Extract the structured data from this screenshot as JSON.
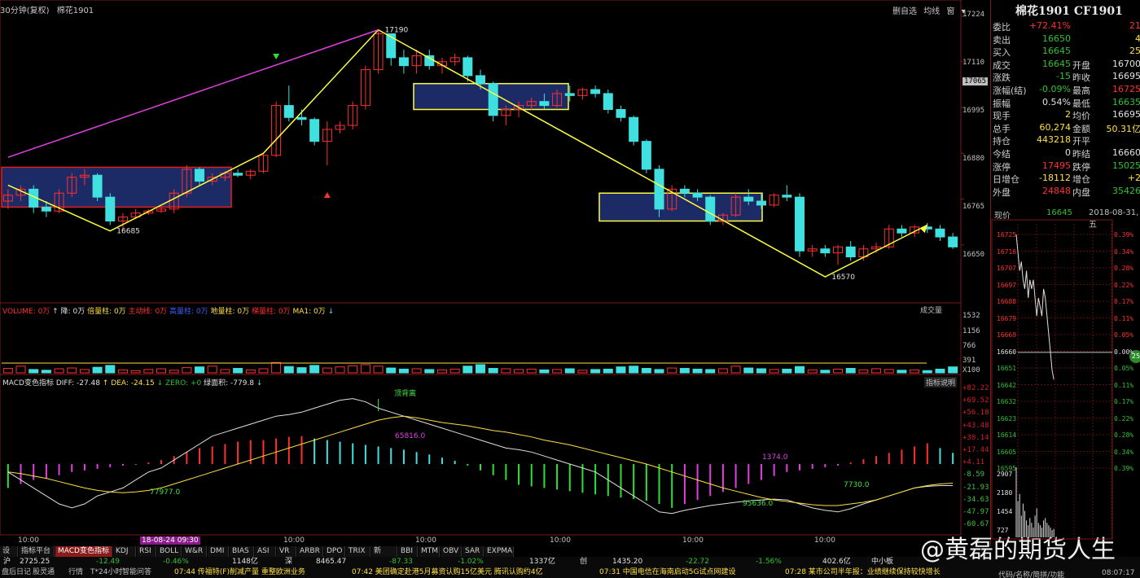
{
  "top": {
    "period": "30分钟(复权)",
    "symbol": "棉花1901",
    "tools": [
      "删自选",
      "均线",
      "窗",
      "▾"
    ]
  },
  "price_axis": [
    "17224",
    "17110",
    "17065",
    "16995",
    "16880",
    "16765",
    "16650"
  ],
  "volume_axis": [
    "1532",
    "1156",
    "766",
    "391",
    "X100"
  ],
  "macd_axis": [
    {
      "v": "+82.22",
      "c": "r"
    },
    {
      "v": "+69.52",
      "c": "r"
    },
    {
      "v": "+56.18",
      "c": "r"
    },
    {
      "v": "+43.48",
      "c": "r"
    },
    {
      "v": "+30.14",
      "c": "r"
    },
    {
      "v": "+17.44",
      "c": "r"
    },
    {
      "v": "+4.11",
      "c": "r"
    },
    {
      "v": "-8.59",
      "c": "g"
    },
    {
      "v": "-21.93",
      "c": "g"
    },
    {
      "v": "-34.63",
      "c": "g"
    },
    {
      "v": "-47.97",
      "c": "g"
    },
    {
      "v": "-60.67",
      "c": "g"
    }
  ],
  "price_labels": {
    "high": "17190",
    "low1": "16685",
    "low2": "16570",
    "chart_label": "成交量"
  },
  "volume_legend": [
    {
      "t": "VOLUME: 0万",
      "c": "red"
    },
    {
      "t": "↑ 降: 0万",
      "c": "white"
    },
    {
      "t": "倍量柱: 0万",
      "c": "yellow"
    },
    {
      "t": "主动线: 0万",
      "c": "red"
    },
    {
      "t": "高量柱: 0万",
      "c": "blue"
    },
    {
      "t": "地量柱: 0万",
      "c": "yellow"
    },
    {
      "t": "梯量柱: 0万",
      "c": "red"
    },
    {
      "t": "MA1: 0万",
      "c": "yellow"
    },
    {
      "t": "↓",
      "c": "cyan"
    }
  ],
  "macd_legend": [
    {
      "t": "MACD变色指标 DIFF: -27.48",
      "c": "white"
    },
    {
      "t": "↑ DEA: -24.15",
      "c": "yellow"
    },
    {
      "t": "↓ ZERO: +0",
      "c": "green"
    },
    {
      "t": "绿面积: -779.8",
      "c": "white"
    },
    {
      "t": "↓",
      "c": "cyan"
    }
  ],
  "macd_annotations": {
    "top_div": "顶背离",
    "a1": "65816.0",
    "a2": "77977.0",
    "a3": "1374.0",
    "a4": "7730.0",
    "a5": "95636.0",
    "explain": "指标说明"
  },
  "x_labels": [
    "10:00",
    "18-08-24 09:30",
    "10:00",
    "10:00",
    "10:00",
    "10:00",
    "10:00"
  ],
  "tabs": [
    "设置",
    "指标平台",
    "MACD变色指标",
    "KDJ",
    "RSI",
    "BOLL",
    "W&R",
    "DMI",
    "BIAS",
    "ASI",
    "VR",
    "ARBR",
    "DPO",
    "TRIX",
    "新DMA",
    "BBI",
    "MTM",
    "OBV",
    "SAR",
    "EXPMA"
  ],
  "index_bar": [
    {
      "t": "沪",
      "c": "white"
    },
    {
      "t": "2725.25",
      "c": "white"
    },
    {
      "t": "-12.49",
      "c": "white"
    },
    {
      "t": "-0.46%",
      "c": "white"
    },
    {
      "t": "1148亿",
      "c": "white"
    },
    {
      "t": "深",
      "c": "white"
    },
    {
      "t": "8465.47",
      "c": "white"
    },
    {
      "t": "-87.33",
      "c": "white"
    },
    {
      "t": "-1.02%",
      "c": "white"
    },
    {
      "t": "1337亿",
      "c": "white"
    },
    {
      "t": "创",
      "c": "white"
    },
    {
      "t": "1435.20",
      "c": "white"
    },
    {
      "t": "-22.72",
      "c": "white"
    },
    {
      "t": "-1.56%",
      "c": "white"
    },
    {
      "t": "402.6亿",
      "c": "white"
    },
    {
      "t": "中小板",
      "c": "white"
    }
  ],
  "news": [
    "盘后日记",
    "股灵通",
    "行情",
    "T*24小时",
    "智能问答",
    "07:44 传福特(F)削减产量 重整欧洲业务",
    "07:42 美团确定赴港5月募资认购15亿美元 腾讯认购约4亿",
    "07:31 中国电信在海南启动5G试点网建设",
    "07:28 某市公司半年报：业绩继续保持较快增长"
  ],
  "bottom_right": [
    "代码/名称/简拼/功能",
    "08:07:17"
  ],
  "quote": {
    "title": "棉花1901 CF1901",
    "rows": [
      {
        "l1": "委比",
        "v1": "+72.41%",
        "c1": "red",
        "l2": "",
        "v2": "21",
        "c2": "red"
      },
      {
        "l1": "卖出",
        "v1": "16650",
        "c1": "green",
        "l2": "",
        "v2": "4",
        "c2": "yellow"
      },
      {
        "l1": "买入",
        "v1": "16645",
        "c1": "green",
        "l2": "",
        "v2": "25",
        "c2": "yellow"
      },
      {
        "l1": "成交",
        "v1": "16645",
        "c1": "green",
        "l2": "开盘",
        "v2": "16700",
        "c2": "white"
      },
      {
        "l1": "涨跌",
        "v1": "-15",
        "c1": "green",
        "l2": "昨收",
        "v2": "16695",
        "c2": "white"
      },
      {
        "l1": "涨幅(结)",
        "v1": "-0.09%",
        "c1": "green",
        "l2": "最高",
        "v2": "16725",
        "c2": "red"
      },
      {
        "l1": "振幅",
        "v1": "0.54%",
        "c1": "white",
        "l2": "最低",
        "v2": "16635",
        "c2": "green"
      },
      {
        "l1": "现手",
        "v1": "2",
        "c1": "yellow",
        "l2": "均价",
        "v2": "16695",
        "c2": "white"
      },
      {
        "l1": "总手",
        "v1": "60,274",
        "c1": "yellow",
        "l2": "金额",
        "v2": "50.31亿",
        "c2": "yellow"
      },
      {
        "l1": "持仓",
        "v1": "443218",
        "c1": "yellow",
        "l2": "开平",
        "v2": "",
        "c2": "white"
      },
      {
        "l1": "今结",
        "v1": "0",
        "c1": "white",
        "l2": "昨结",
        "v2": "16660",
        "c2": "white"
      },
      {
        "l1": "涨停",
        "v1": "17495",
        "c1": "red",
        "l2": "跌停",
        "v2": "15025",
        "c2": "green"
      },
      {
        "l1": "日增仓",
        "v1": "-18112",
        "c1": "yellow",
        "l2": "增仓",
        "v2": "+2",
        "c2": "yellow"
      },
      {
        "l1": "外盘",
        "v1": "24848",
        "c1": "red",
        "l2": "内盘",
        "v2": "35426",
        "c2": "green"
      }
    ],
    "now_label": "现价",
    "now_value": "16645",
    "date": "2018-08-31,五"
  },
  "mini_left_axis": [
    {
      "v": "16725",
      "c": "r"
    },
    {
      "v": "16716",
      "c": "r"
    },
    {
      "v": "16707",
      "c": "r"
    },
    {
      "v": "16697",
      "c": "r"
    },
    {
      "v": "16688",
      "c": "r"
    },
    {
      "v": "16679",
      "c": "r"
    },
    {
      "v": "16669",
      "c": "r"
    },
    {
      "v": "16660",
      "c": "w"
    },
    {
      "v": "16651",
      "c": "g"
    },
    {
      "v": "16642",
      "c": "g"
    },
    {
      "v": "16632",
      "c": "g"
    },
    {
      "v": "16623",
      "c": "g"
    },
    {
      "v": "16614",
      "c": "g"
    },
    {
      "v": "16605",
      "c": "g"
    },
    {
      "v": "16595",
      "c": "g"
    }
  ],
  "mini_right_axis": [
    {
      "v": "0.39%",
      "c": "r"
    },
    {
      "v": "0.34%",
      "c": "r"
    },
    {
      "v": "0.28%",
      "c": "r"
    },
    {
      "v": "0.22%",
      "c": "r"
    },
    {
      "v": "0.17%",
      "c": "r"
    },
    {
      "v": "0.11%",
      "c": "r"
    },
    {
      "v": "0.05%",
      "c": "r"
    },
    {
      "v": "0.00%",
      "c": "w"
    },
    {
      "v": "0.05%",
      "c": "g"
    },
    {
      "v": "0.11%",
      "c": "g"
    },
    {
      "v": "0.17%",
      "c": "g"
    },
    {
      "v": "0.22%",
      "c": "g"
    },
    {
      "v": "0.28%",
      "c": "g"
    },
    {
      "v": "0.34%",
      "c": "g"
    },
    {
      "v": "0.39%",
      "c": "g"
    }
  ],
  "mini_vol_axis": [
    "2907",
    "2180",
    "1454",
    "727"
  ],
  "mini_badge": "25",
  "watermark": "@黄磊的期货人生",
  "chart_data": {
    "type": "candlestick",
    "candles": [
      [
        16760,
        16790,
        16740,
        16775
      ],
      [
        16775,
        16800,
        16760,
        16790
      ],
      [
        16790,
        16800,
        16730,
        16745
      ],
      [
        16745,
        16760,
        16720,
        16735
      ],
      [
        16735,
        16790,
        16730,
        16780
      ],
      [
        16780,
        16830,
        16770,
        16820
      ],
      [
        16820,
        16840,
        16800,
        16825
      ],
      [
        16825,
        16830,
        16760,
        16770
      ],
      [
        16770,
        16780,
        16700,
        16710
      ],
      [
        16710,
        16730,
        16685,
        16720
      ],
      [
        16720,
        16740,
        16715,
        16730
      ],
      [
        16730,
        16740,
        16725,
        16735
      ],
      [
        16735,
        16745,
        16730,
        16740
      ],
      [
        16740,
        16790,
        16730,
        16780
      ],
      [
        16780,
        16850,
        16770,
        16840
      ],
      [
        16840,
        16845,
        16800,
        16810
      ],
      [
        16810,
        16830,
        16800,
        16820
      ],
      [
        16820,
        16835,
        16810,
        16830
      ],
      [
        16830,
        16840,
        16820,
        16825
      ],
      [
        16825,
        16840,
        16815,
        16835
      ],
      [
        16835,
        16880,
        16830,
        16875
      ],
      [
        16875,
        17010,
        16870,
        17000
      ],
      [
        17000,
        17050,
        16960,
        16970
      ],
      [
        16970,
        16990,
        16950,
        16965
      ],
      [
        16965,
        16970,
        16900,
        16910
      ],
      [
        16910,
        16960,
        16850,
        16940
      ],
      [
        16940,
        16960,
        16930,
        16950
      ],
      [
        16950,
        17010,
        16940,
        17000
      ],
      [
        17000,
        17100,
        16990,
        17090
      ],
      [
        17090,
        17190,
        17080,
        17180
      ],
      [
        17180,
        17170,
        17100,
        17120
      ],
      [
        17120,
        17140,
        17080,
        17100
      ],
      [
        17100,
        17140,
        17080,
        17125
      ],
      [
        17125,
        17140,
        17090,
        17100
      ],
      [
        17100,
        17120,
        17080,
        17110
      ],
      [
        17110,
        17130,
        17100,
        17120
      ],
      [
        17120,
        17125,
        17060,
        17075
      ],
      [
        17075,
        17090,
        17040,
        17055
      ],
      [
        17055,
        17060,
        16960,
        16975
      ],
      [
        16975,
        17000,
        16950,
        16990
      ],
      [
        16990,
        17010,
        16970,
        17000
      ],
      [
        17000,
        17020,
        16990,
        17010
      ],
      [
        17010,
        17030,
        16990,
        17000
      ],
      [
        17000,
        17040,
        16995,
        17030
      ],
      [
        17030,
        17050,
        17010,
        17025
      ],
      [
        17025,
        17045,
        17015,
        17040
      ],
      [
        17040,
        17050,
        17020,
        17030
      ],
      [
        17030,
        17040,
        16980,
        16990
      ],
      [
        16990,
        17000,
        16960,
        16970
      ],
      [
        16970,
        16975,
        16900,
        16910
      ],
      [
        16910,
        16915,
        16830,
        16840
      ],
      [
        16840,
        16850,
        16720,
        16740
      ],
      [
        16740,
        16800,
        16735,
        16790
      ],
      [
        16790,
        16800,
        16770,
        16780
      ],
      [
        16780,
        16790,
        16760,
        16770
      ],
      [
        16770,
        16775,
        16700,
        16710
      ],
      [
        16710,
        16730,
        16700,
        16725
      ],
      [
        16725,
        16780,
        16720,
        16770
      ],
      [
        16770,
        16790,
        16750,
        16760
      ],
      [
        16760,
        16780,
        16740,
        16750
      ],
      [
        16750,
        16780,
        16745,
        16775
      ],
      [
        16775,
        16800,
        16760,
        16770
      ],
      [
        16770,
        16780,
        16620,
        16635
      ],
      [
        16635,
        16650,
        16620,
        16640
      ],
      [
        16640,
        16650,
        16620,
        16630
      ],
      [
        16630,
        16650,
        16600,
        16645
      ],
      [
        16645,
        16660,
        16610,
        16620
      ],
      [
        16620,
        16650,
        16610,
        16640
      ],
      [
        16640,
        16655,
        16630,
        16645
      ],
      [
        16645,
        16700,
        16640,
        16690
      ],
      [
        16690,
        16700,
        16670,
        16680
      ],
      [
        16680,
        16700,
        16670,
        16695
      ],
      [
        16695,
        16705,
        16680,
        16690
      ],
      [
        16690,
        16700,
        16660,
        16670
      ],
      [
        16670,
        16680,
        16640,
        16645
      ]
    ],
    "y_range": [
      16570,
      17224
    ],
    "trendlines": [
      [
        16700,
        16685,
        16845,
        17190,
        16570,
        16700
      ]
    ],
    "volumes": [
      120,
      180,
      90,
      70,
      110,
      130,
      90,
      150,
      200,
      80,
      60,
      90,
      110,
      70,
      140,
      160,
      180,
      90,
      120,
      80,
      110,
      280,
      170,
      140,
      200,
      130,
      160,
      190,
      220,
      180,
      130,
      100,
      110,
      90,
      80,
      100,
      180,
      220,
      120,
      110,
      90,
      100,
      80,
      90,
      110,
      70,
      90,
      100,
      160,
      180,
      120,
      90,
      130,
      120,
      100,
      90,
      110,
      180,
      130,
      110,
      90,
      100,
      170,
      80,
      70,
      100,
      120,
      80,
      110,
      90,
      70,
      80,
      60,
      100,
      160
    ],
    "macd_hist": [
      -30,
      -25,
      -20,
      -18,
      -14,
      -10,
      -8,
      -6,
      -4,
      -2,
      -1,
      2,
      5,
      10,
      15,
      20,
      22,
      25,
      28,
      30,
      30,
      32,
      34,
      35,
      32,
      30,
      28,
      26,
      24,
      22,
      20,
      18,
      15,
      12,
      8,
      4,
      -2,
      -8,
      -14,
      -20,
      -26,
      -28,
      -30,
      -32,
      -34,
      -36,
      -38,
      -40,
      -42,
      -44,
      -46,
      -50,
      -55,
      -50,
      -45,
      -40,
      -35,
      -30,
      -25,
      -20,
      -15,
      -10,
      -8,
      -6,
      -4,
      -2,
      2,
      6,
      10,
      14,
      18,
      22,
      26,
      20,
      14
    ],
    "macd_diff": [
      -10,
      -20,
      -30,
      -40,
      -50,
      -55,
      -50,
      -40,
      -35,
      -30,
      -20,
      -10,
      -5,
      5,
      15,
      25,
      35,
      40,
      45,
      50,
      55,
      60,
      62,
      65,
      70,
      75,
      80,
      82,
      78,
      70,
      65,
      60,
      55,
      50,
      45,
      40,
      35,
      30,
      25,
      20,
      18,
      15,
      10,
      5,
      0,
      -5,
      -10,
      -20,
      -30,
      -40,
      -50,
      -60,
      -62,
      -58,
      -55,
      -52,
      -50,
      -48,
      -46,
      -45,
      -44,
      -45,
      -50,
      -55,
      -58,
      -60,
      -56,
      -50,
      -45,
      -40,
      -35,
      -30,
      -28,
      -27,
      -27
    ],
    "macd_dea": [
      -10,
      -12,
      -15,
      -18,
      -22,
      -26,
      -30,
      -33,
      -35,
      -36,
      -35,
      -33,
      -30,
      -25,
      -20,
      -15,
      -10,
      -5,
      0,
      5,
      10,
      15,
      20,
      25,
      30,
      35,
      40,
      45,
      50,
      55,
      58,
      60,
      58,
      55,
      52,
      50,
      48,
      45,
      42,
      40,
      37,
      34,
      30,
      27,
      24,
      20,
      16,
      12,
      8,
      4,
      0,
      -5,
      -10,
      -15,
      -20,
      -25,
      -30,
      -34,
      -38,
      -42,
      -45,
      -47,
      -49,
      -51,
      -52,
      -52,
      -50,
      -48,
      -45,
      -40,
      -35,
      -30,
      -27,
      -25,
      -24
    ],
    "intraday_price": [
      16725,
      16715,
      16705,
      16710,
      16700,
      16695,
      16705,
      16690,
      16700,
      16695,
      16700,
      16690,
      16680,
      16690,
      16685,
      16680,
      16695,
      16690,
      16680,
      16670,
      16660,
      16650,
      16645
    ],
    "intraday_volume": [
      2907,
      1500,
      1800,
      900,
      1400,
      1100,
      700,
      500,
      800,
      600,
      400,
      900,
      1200,
      600,
      500,
      400,
      700,
      800,
      600,
      500,
      400,
      300,
      350
    ]
  }
}
